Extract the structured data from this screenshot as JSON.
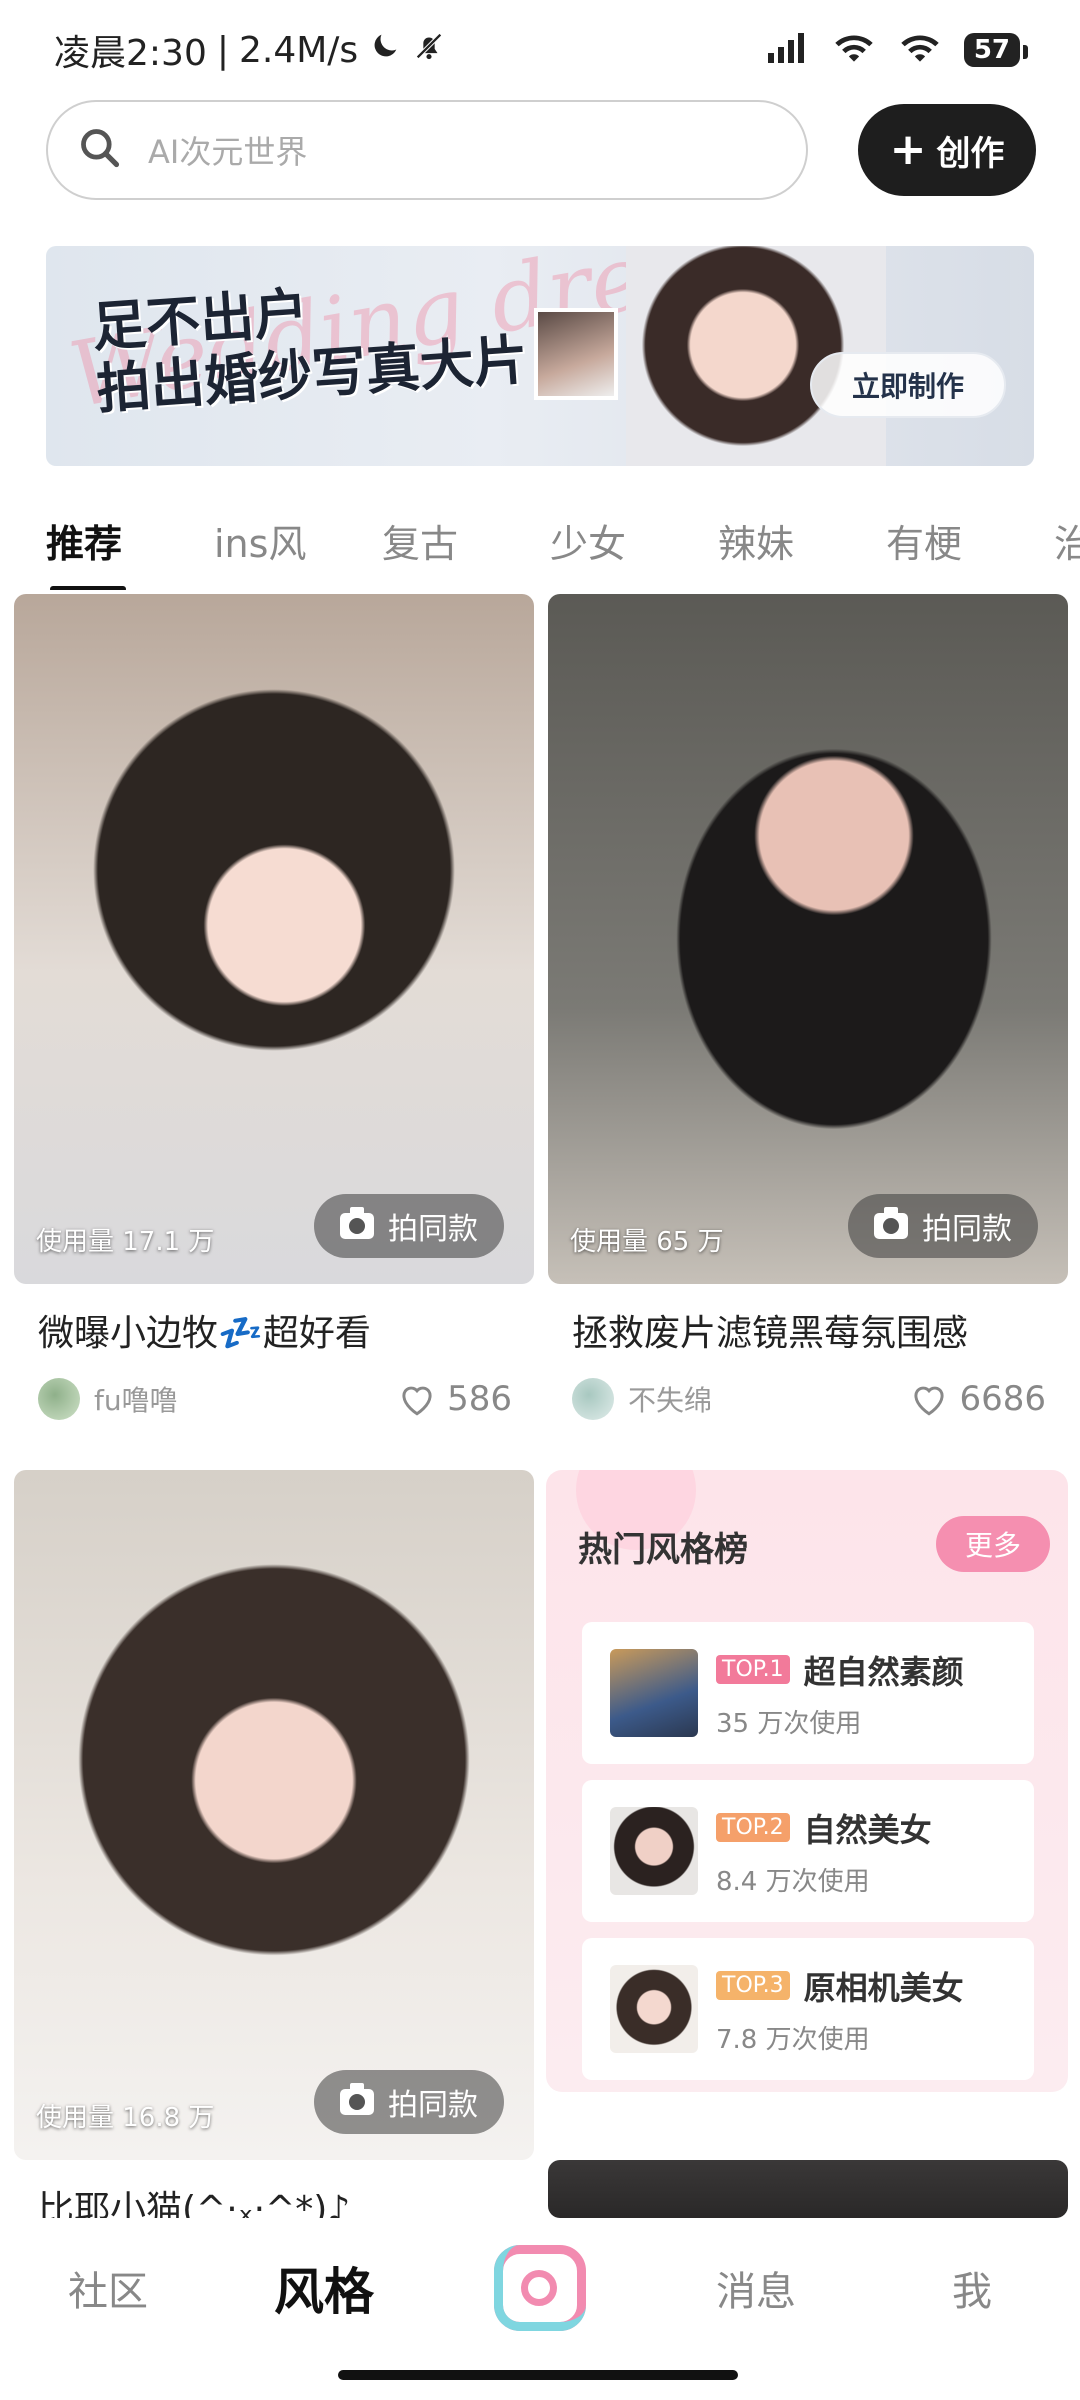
{
  "status_bar": {
    "time": "凌晨2:30",
    "separator": "|",
    "speed": "2.4M/s",
    "battery": "57",
    "icons": [
      "moon-icon",
      "mute-bell-icon",
      "signal-icon",
      "wifi-alt-icon",
      "wifi-icon",
      "battery-icon"
    ]
  },
  "search": {
    "placeholder": "AI次元世界"
  },
  "create_button": {
    "label": "创作"
  },
  "banner": {
    "script_text": "Wedding dress",
    "title_line1": "足不出户",
    "title_line2": "拍出婚纱写真大片",
    "cta": "立即制作"
  },
  "tabs": [
    "推荐",
    "ins风",
    "复古",
    "少女",
    "辣妹",
    "有梗",
    "治"
  ],
  "cards": [
    {
      "usage": "使用量 17.1 万",
      "action": "拍同款",
      "title": "微曝小边牧💤超好看",
      "author": "fu噜噜",
      "likes": "586"
    },
    {
      "usage": "使用量 65 万",
      "action": "拍同款",
      "title": "拯救废片滤镜黑莓氛围感",
      "author": "不失绵",
      "likes": "6686"
    },
    {
      "usage": "使用量 16.8 万",
      "action": "拍同款",
      "title": "比耶小猫(^·ₓ·^*)♪"
    }
  ],
  "ranking": {
    "title": "热门风格榜",
    "more": "更多",
    "items": [
      {
        "badge": "TOP.1",
        "name": "超自然素颜",
        "uses": "35 万次使用"
      },
      {
        "badge": "TOP.2",
        "name": "自然美女",
        "uses": "8.4 万次使用"
      },
      {
        "badge": "TOP.3",
        "name": "原相机美女",
        "uses": "7.8 万次使用"
      }
    ],
    "colors": {
      "top1": "#f27a9a",
      "top2": "#f5a06a",
      "top3": "#f5b36a"
    }
  },
  "bottom_nav": {
    "community": "社区",
    "style": "风格",
    "messages": "消息",
    "me": "我"
  }
}
